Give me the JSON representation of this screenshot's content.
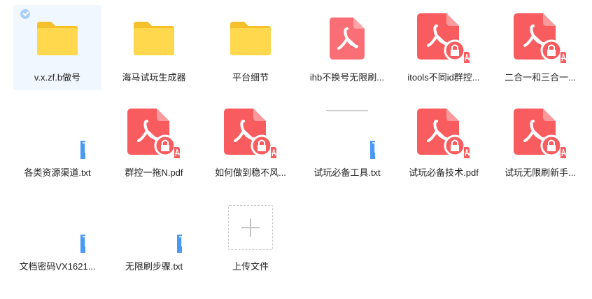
{
  "colors": {
    "folder": "#ffd84d",
    "pdf": "#f85c5f",
    "txt_badge": "#4a9af5",
    "selected_bg": "#f1f7fe"
  },
  "files": [
    {
      "name": "v.x.zf.b做号",
      "kind": "folder-icon",
      "selected": true
    },
    {
      "name": "海马试玩生成器",
      "kind": "folder-icon"
    },
    {
      "name": "平台细节",
      "kind": "folder-icon"
    },
    {
      "name": "ihb不换号无限刷...",
      "kind": "pdf-icon"
    },
    {
      "name": "itools不同id群控...",
      "kind": "pdf-locked-icon"
    },
    {
      "name": "二合一和三合一...",
      "kind": "pdf-locked-icon"
    },
    {
      "name": "各类资源渠道.txt",
      "kind": "txt-icon"
    },
    {
      "name": "群控一拖N.pdf",
      "kind": "pdf-locked-icon"
    },
    {
      "name": "如何做到稳不风...",
      "kind": "pdf-locked-icon"
    },
    {
      "name": "试玩必备工具.txt",
      "kind": "txt-icon"
    },
    {
      "name": "试玩必备技术.pdf",
      "kind": "pdf-locked-icon"
    },
    {
      "name": "试玩无限刷新手...",
      "kind": "pdf-locked-icon"
    },
    {
      "name": "文档密码VX1621...",
      "kind": "txt-icon"
    },
    {
      "name": "无限刷步骤.txt",
      "kind": "txt-icon"
    },
    {
      "name": "上传文件",
      "kind": "upload-plus-icon"
    }
  ]
}
